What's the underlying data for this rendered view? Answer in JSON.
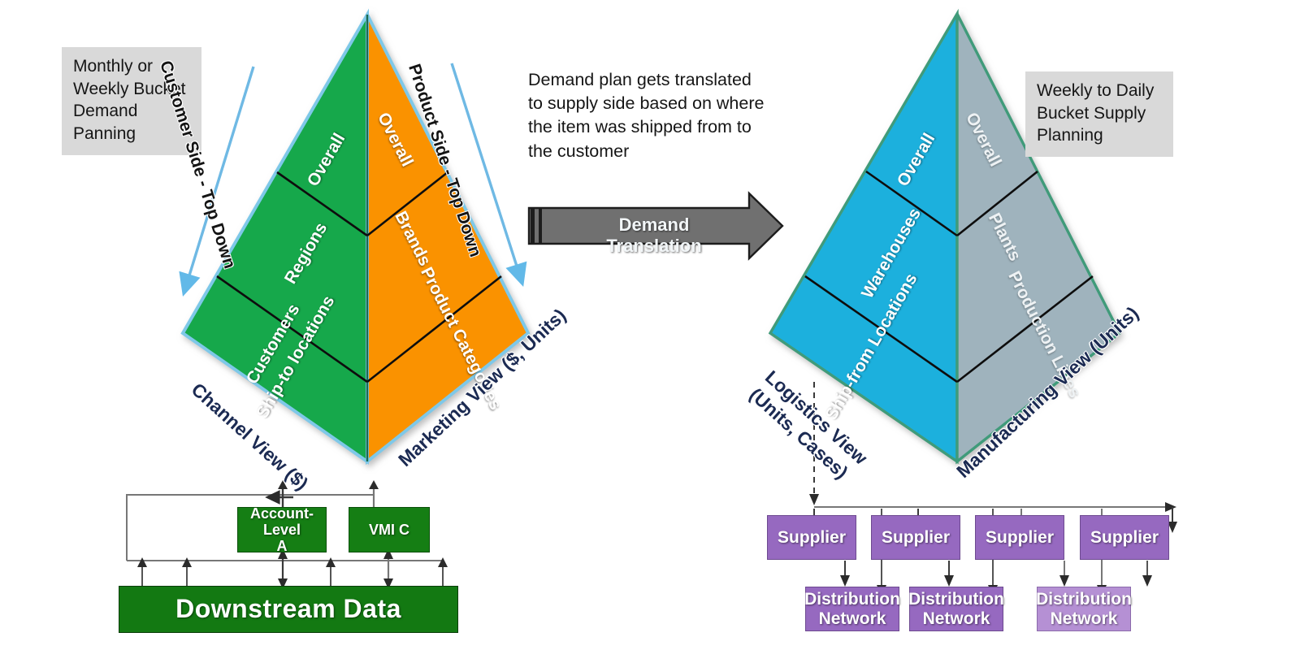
{
  "notes": {
    "left": "Monthly or\nWeekly Bucket\nDemand\nPanning",
    "right": "Weekly to Daily\nBucket Supply\nPlanning",
    "center": "Demand plan gets translated\nto supply side based on where\nthe item was shipped from to\nthe customer"
  },
  "translation_arrow": {
    "label": "Demand Translation"
  },
  "demand_pyramid": {
    "side_captions": {
      "left": "Customer Side - Top Down",
      "right": "Product Side - Top Down"
    },
    "base_labels": {
      "left": "Channel View ($)",
      "right": "Marketing View ($, Units)"
    },
    "left_face": {
      "color": "#16a84b",
      "tiers": [
        "Overall",
        "Regions",
        "Customers\nShip-to locations"
      ]
    },
    "right_face": {
      "color": "#fa9200",
      "tiers": [
        "Overall",
        "Brands",
        "Product Categories"
      ]
    }
  },
  "supply_pyramid": {
    "base_labels": {
      "left": "Logistics View\n(Units, Cases)",
      "right": "Manufacturing View  (Units)"
    },
    "left_face": {
      "color": "#1eb0dd",
      "tiers": [
        "Overall",
        "Warehouses",
        "Ship-from Locations"
      ]
    },
    "right_face": {
      "color": "#9fb3bd",
      "tiers": [
        "Overall",
        "Plants",
        "Production  Lines"
      ]
    }
  },
  "demand_network": {
    "nodes": [
      {
        "label": "Account-Level\nA",
        "style": "green"
      },
      {
        "label": "VMI C",
        "style": "green"
      }
    ],
    "foundation": {
      "label": "Downstream Data",
      "style": "bigbar"
    }
  },
  "supply_network": {
    "suppliers": [
      {
        "label": "Supplier",
        "style": "purple"
      },
      {
        "label": "Supplier",
        "style": "purple"
      },
      {
        "label": "Supplier",
        "style": "purple"
      },
      {
        "label": "Supplier",
        "style": "purple"
      }
    ],
    "distribution_networks": [
      {
        "label": "Distribution\nNetwork",
        "style": "purple"
      },
      {
        "label": "Distribution\nNetwork",
        "style": "purple"
      },
      {
        "label": "Distribution\nNetwork",
        "style": "purple-light"
      }
    ]
  },
  "colors": {
    "green": "#16a84b",
    "orange": "#fa9200",
    "blue": "#1eb0dd",
    "gray_blue": "#9fb3bd",
    "purple": "#9669c0",
    "purple_light": "#b590d4",
    "dark_green": "#157e14",
    "arrow_gray": "#707070",
    "note_gray": "#d9d9d9",
    "navy_text": "#1b2a52"
  }
}
